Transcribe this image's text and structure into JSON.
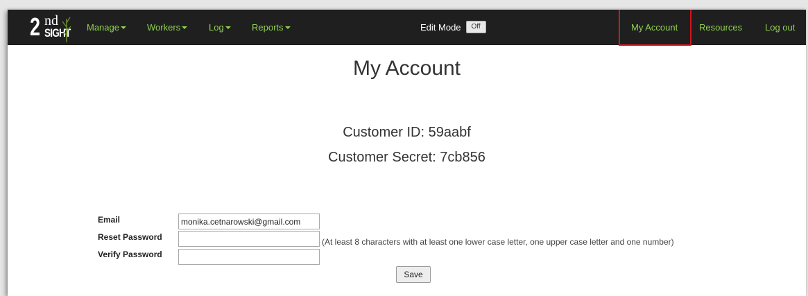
{
  "logo": {
    "number": "2",
    "suffix": "nd",
    "word": "SIGHT"
  },
  "nav": {
    "menus": [
      {
        "label": "Manage",
        "icon": "caret-down-icon"
      },
      {
        "label": "Workers",
        "icon": "caret-down-icon"
      },
      {
        "label": "Log",
        "icon": "caret-down-icon"
      },
      {
        "label": "Reports",
        "icon": "caret-down-icon"
      }
    ],
    "edit_mode_label": "Edit Mode",
    "edit_mode_toggle": "Off",
    "right_links": [
      {
        "label": "My Account"
      },
      {
        "label": "Resources"
      },
      {
        "label": "Log out"
      }
    ]
  },
  "page": {
    "title": "My Account",
    "customer_id": "Customer ID: 59aabf",
    "customer_secret": "Customer Secret: 7cb856"
  },
  "form": {
    "email_label": "Email",
    "email_value": "monika.cetnarowski@gmail.com",
    "reset_password_label": "Reset Password",
    "reset_password_value": "",
    "verify_password_label": "Verify Password",
    "verify_password_value": "",
    "password_hint": "(At least 8 characters with at least one lower case letter, one upper case letter and one number)",
    "save_label": "Save"
  },
  "colors": {
    "navbar_bg": "#1f1f1f",
    "nav_link": "#8fd14f",
    "highlight": "#d0161c"
  }
}
